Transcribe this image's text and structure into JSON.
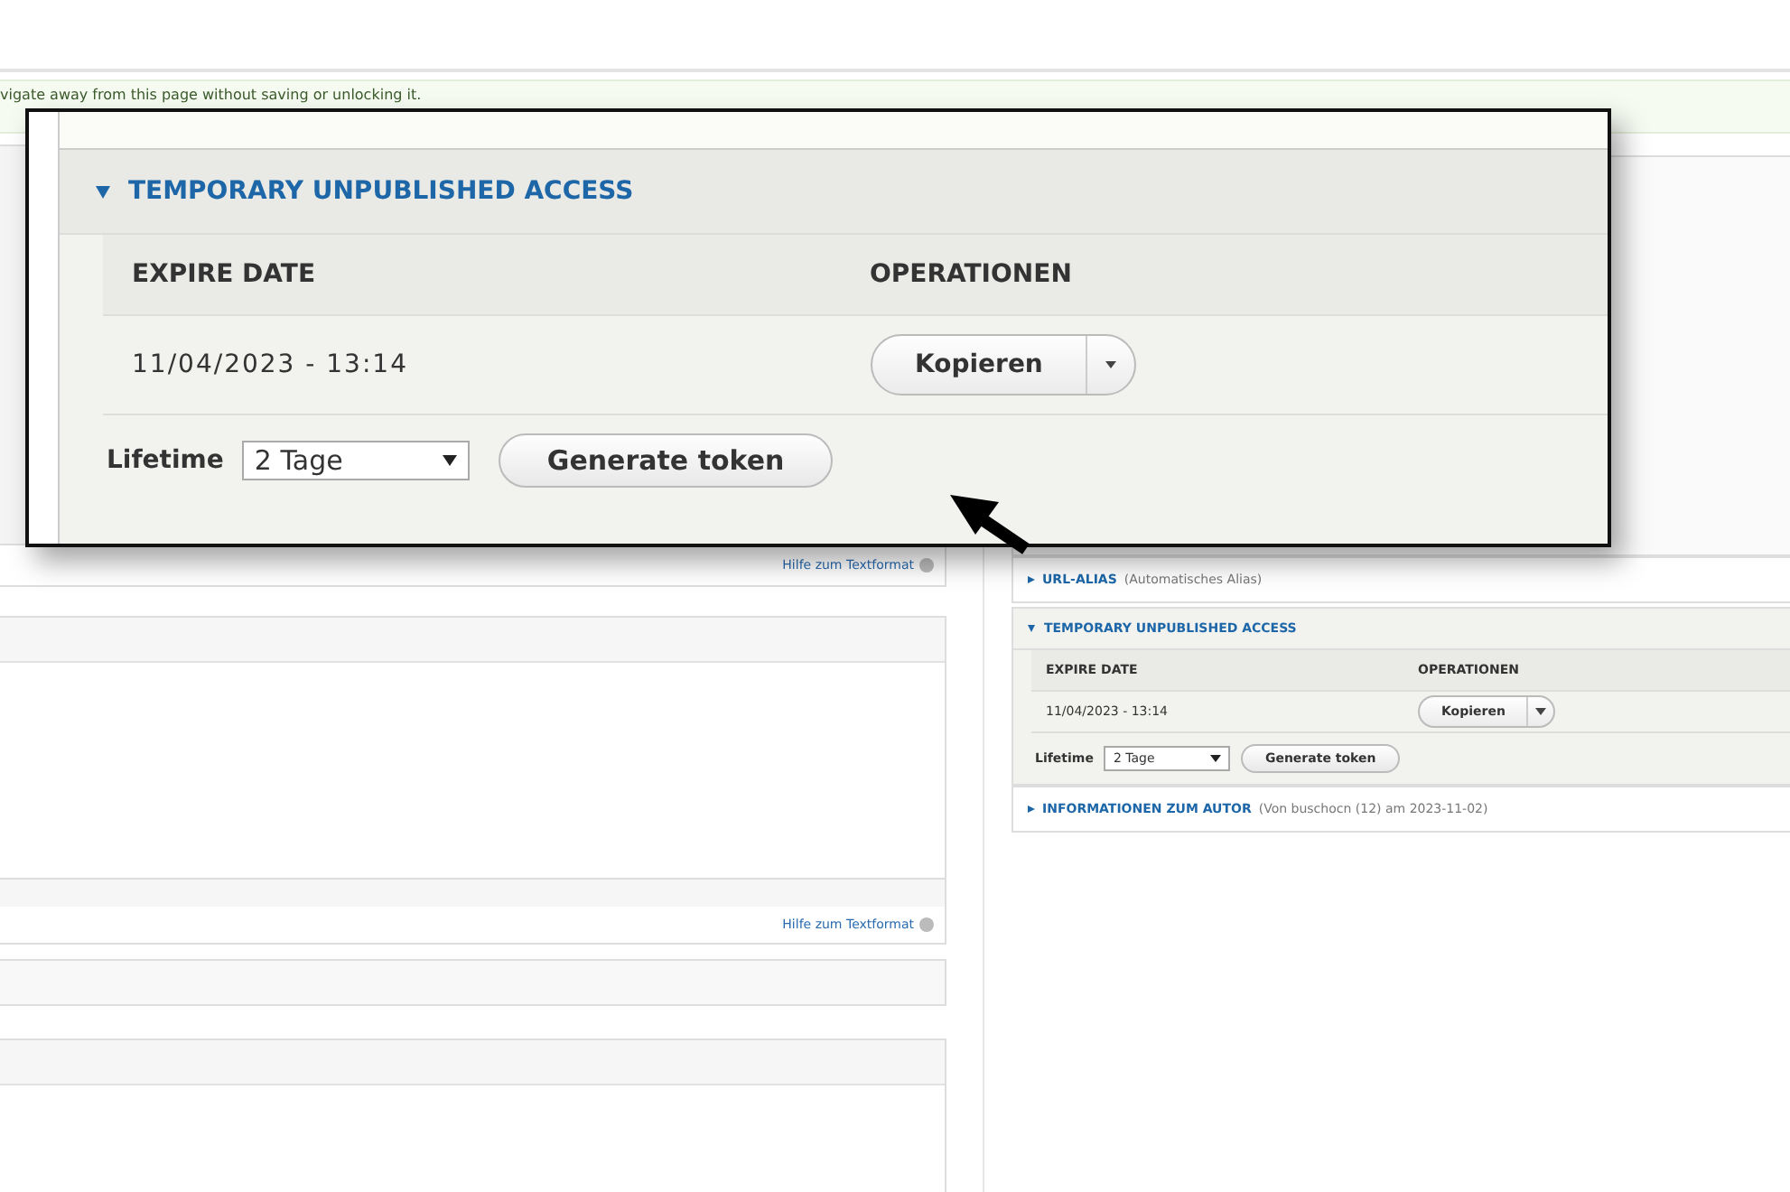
{
  "message": {
    "text": "vigate away from this page without saving or unlocking it."
  },
  "left_column": {
    "help_links": [
      "Hilfe zum Textformat",
      "Hilfe zum Textformat"
    ]
  },
  "right_column": {
    "sections": [
      {
        "kind": "collapsed",
        "title": "URL-ALIAS",
        "summary": "(Automatisches Alias)",
        "expanded": false
      },
      {
        "kind": "access",
        "title": "TEMPORARY UNPUBLISHED ACCESS",
        "expanded": true,
        "columns": [
          "EXPIRE DATE",
          "OPERATIONEN"
        ],
        "rows": [
          {
            "expire_date": "11/04/2023 - 13:14",
            "operation": "Kopieren"
          }
        ],
        "lifetime_label": "Lifetime",
        "lifetime_value": "2 Tage",
        "button": "Generate token"
      },
      {
        "kind": "collapsed",
        "title": "INFORMATIONEN ZUM AUTOR",
        "summary": "(Von buschocn (12) am 2023-11-02)",
        "expanded": false
      }
    ]
  },
  "callout": {
    "section": {
      "kind": "access",
      "title": "TEMPORARY UNPUBLISHED ACCESS",
      "expanded": true,
      "columns": [
        "EXPIRE DATE",
        "OPERATIONEN"
      ],
      "rows": [
        {
          "expire_date": "11/04/2023 - 13:14",
          "operation": "Kopieren"
        }
      ],
      "lifetime_label": "Lifetime",
      "lifetime_value": "2 Tage",
      "button": "Generate token"
    }
  }
}
